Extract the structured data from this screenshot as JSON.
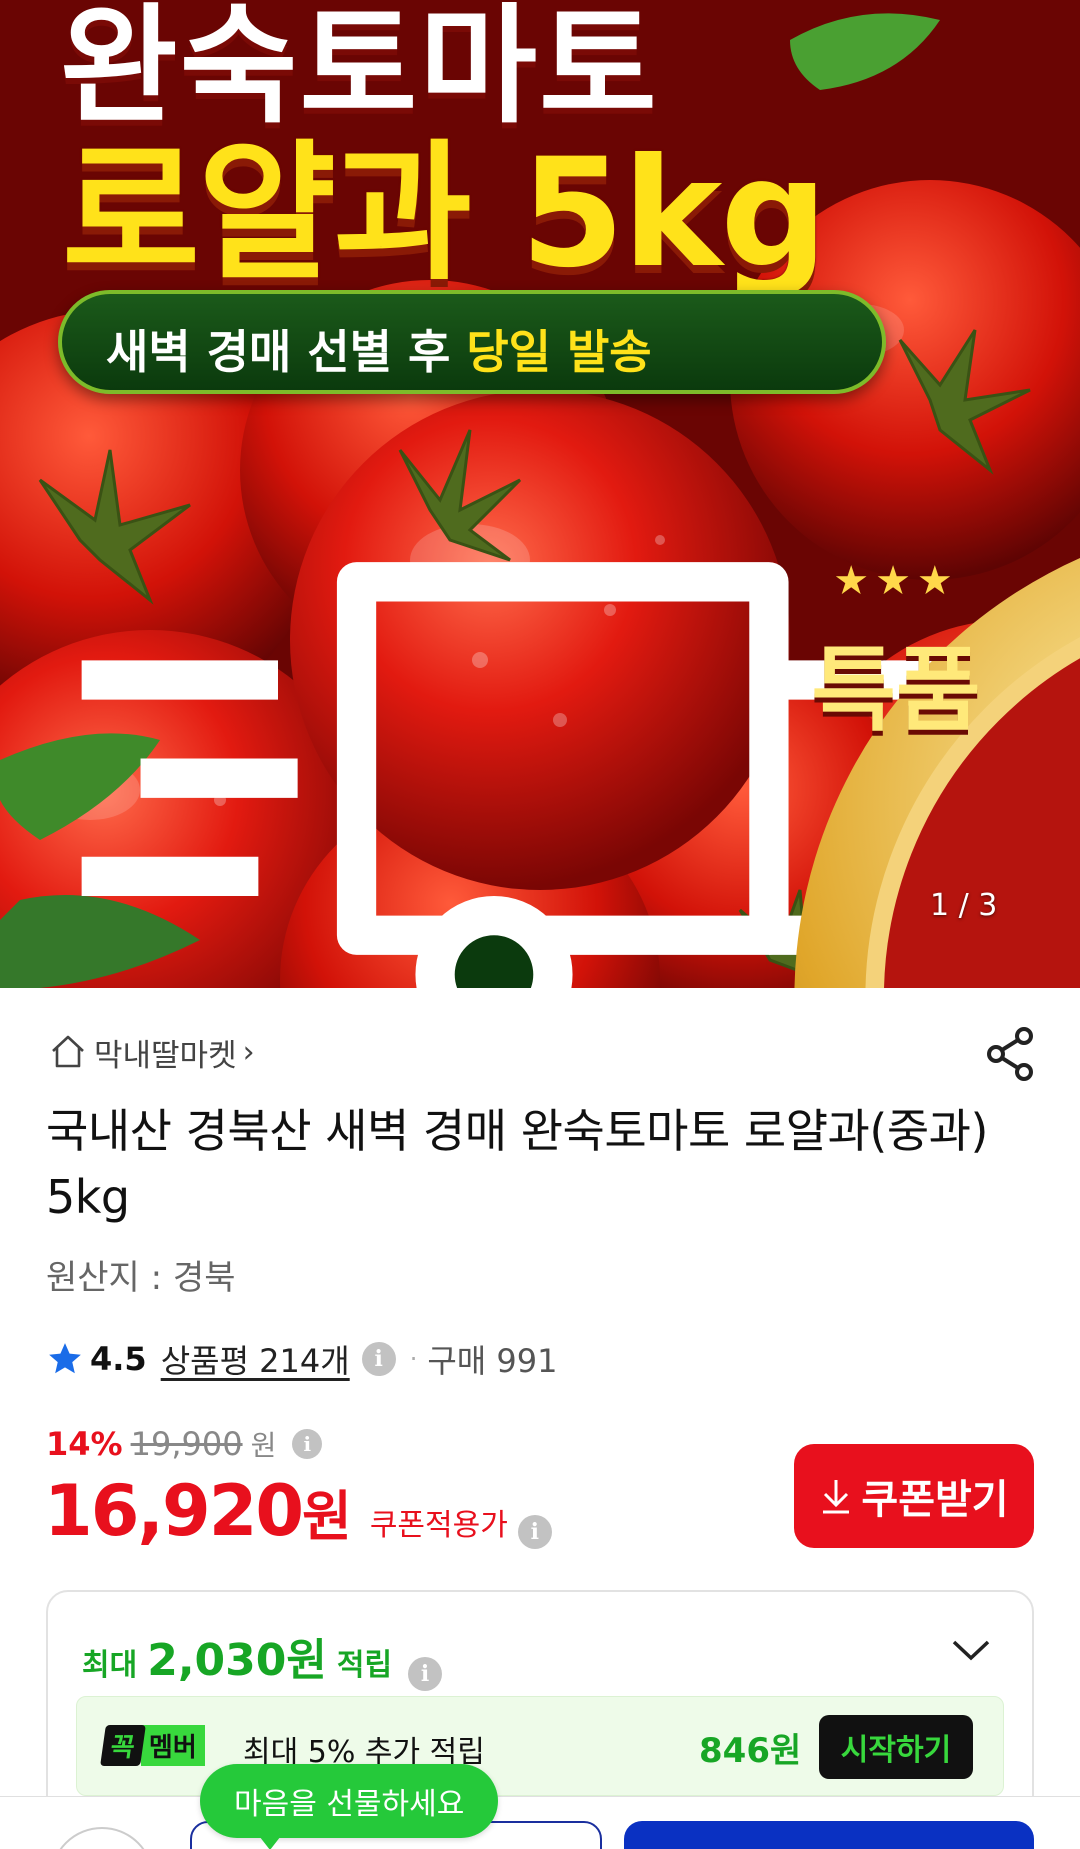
{
  "hero": {
    "title_line1": "완숙토마토",
    "title_line2": "로얄과 5kg",
    "banner_pre": "새벽 경매 ",
    "banner_mid": "선별 후 ",
    "banner_post": "당일 발송",
    "badge_stars": "★★★",
    "badge_text": "특품",
    "counter": "1 / 3"
  },
  "store": {
    "name": "막내딸마켓",
    "chevron": "›"
  },
  "product": {
    "title": "국내산 경북산 새벽 경매 완숙토마토 로얄과(중과) 5kg",
    "origin": "원산지 : 경북"
  },
  "rating": {
    "value": "4.5",
    "reviews": "상품평 214개",
    "separator": "·",
    "purchases": "구매 991"
  },
  "price": {
    "discount_rate": "14%",
    "original": "19,900",
    "original_unit": "원",
    "final": "16,920",
    "final_unit": "원",
    "coupon_label": "쿠폰적용가",
    "coupon_button": "쿠폰받기"
  },
  "reward": {
    "pre": "최대",
    "amount": "2,030원",
    "post": "적립",
    "member_badge_a": "꼭",
    "member_badge_b": "멤버",
    "member_text": "최대 5% 추가 적립",
    "member_amount": "846원",
    "start_button": "시작하기"
  },
  "bottom": {
    "gift_tooltip": "마음을 선물하세요"
  },
  "icons": {
    "info": "i"
  },
  "colors": {
    "accent_red": "#e8101d",
    "reward_green": "#17a625",
    "buy_blue": "#0a31c2",
    "tooltip_green": "#25c93a"
  }
}
